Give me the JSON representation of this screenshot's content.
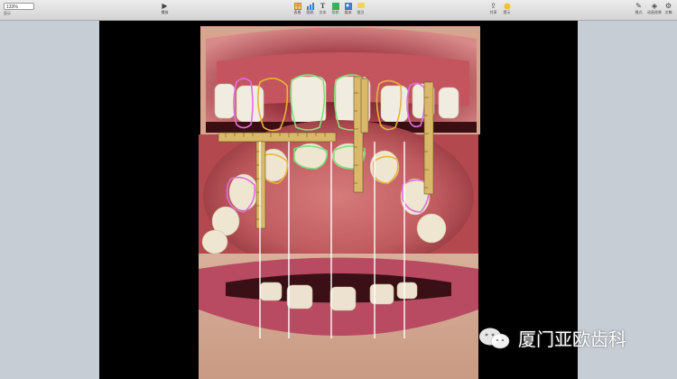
{
  "toolbar": {
    "zoom_value": "133%",
    "zoom_label": "显示",
    "play_label": "播放",
    "insert": [
      {
        "icon": "table-icon",
        "label": "表格",
        "color": "#e8a530"
      },
      {
        "icon": "chart-icon",
        "label": "图表",
        "color": "#3b7bd6"
      },
      {
        "icon": "text-icon",
        "label": "文本",
        "color": "#555555"
      },
      {
        "icon": "shape-icon",
        "label": "形状",
        "color": "#36b35a"
      },
      {
        "icon": "media-icon",
        "label": "媒体",
        "color": "#3b7bd6"
      },
      {
        "icon": "comment-icon",
        "label": "批注",
        "color": "#e8c430"
      }
    ],
    "share_label": "共享",
    "tips_label": "提示",
    "right": [
      {
        "icon": "format-icon",
        "label": "格式"
      },
      {
        "icon": "animate-icon",
        "label": "动画效果"
      },
      {
        "icon": "document-icon",
        "label": "文稿"
      }
    ]
  },
  "watermark": {
    "text": "厦门亚欧齿科"
  },
  "colors": {
    "outline_pink": "#e070d8",
    "outline_yellow": "#e8b43a",
    "outline_green": "#7fe07a",
    "ruler": "#d9b86a"
  }
}
